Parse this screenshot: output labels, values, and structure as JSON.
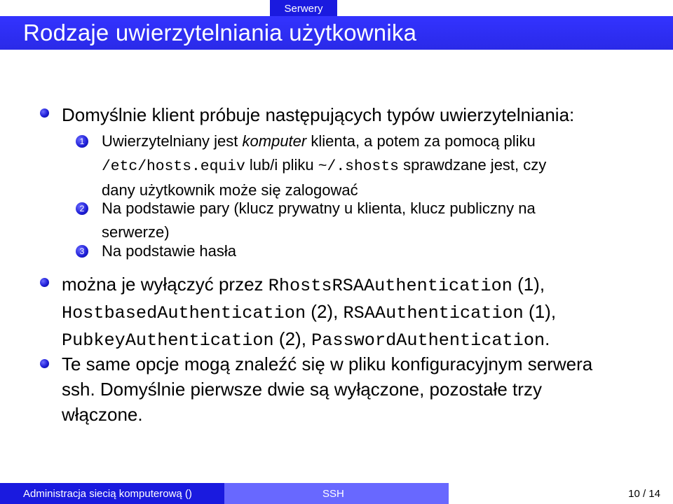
{
  "header": {
    "section": "Serwery",
    "title": "Rodzaje uwierzytelniania użytkownika"
  },
  "bullets": [
    {
      "text": "Domyślnie klient próbuje następujących typów uwierzytelniania:",
      "subitems": [
        {
          "num": "1",
          "parts": {
            "a": "Uwierzytelniany jest ",
            "b": "komputer",
            "c": " klienta, a potem za pomocą pliku",
            "d": "/etc/hosts.equiv",
            "e": " lub/i pliku ",
            "f": "~/.shosts",
            "g": " sprawdzane jest, czy",
            "h": "dany użytkownik może się zalogować"
          }
        },
        {
          "num": "2",
          "line1": "Na podstawie pary (klucz prywatny u klienta, klucz publiczny na",
          "line2": "serwerze)"
        },
        {
          "num": "3",
          "line1": "Na podstawie hasła"
        }
      ]
    },
    {
      "parts": {
        "a": "można je wyłączyć przez ",
        "b": "RhostsRSAAuthentication",
        "c": " (1),",
        "d": "HostbasedAuthentication",
        "e": " (2), ",
        "f": "RSAAuthentication",
        "g": " (1),",
        "h": "PubkeyAuthentication",
        "i": " (2), ",
        "j": "PasswordAuthentication",
        "k": "."
      }
    },
    {
      "line1": "Te same opcje mogą znaleźć się w pliku konfiguracyjnym serwera",
      "line2": "ssh. Domyślnie pierwsze dwie są wyłączone, pozostałe trzy",
      "line3": "włączone."
    }
  ],
  "footer": {
    "left": "Administracja siecią komputerową ()",
    "middle": "SSH",
    "right": "10 / 14"
  },
  "colors": {
    "title_bar": "#3333ff",
    "footer_dark": "#1a1adf",
    "footer_light": "#6868ff",
    "bullet": "#1d1dd6"
  }
}
